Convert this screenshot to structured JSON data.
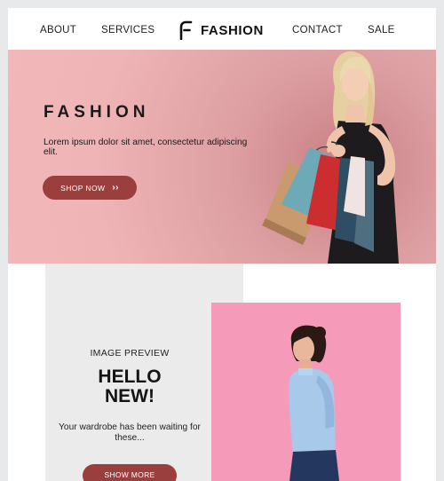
{
  "nav": {
    "links": [
      "ABOUT",
      "SERVICES",
      "CONTACT",
      "SALE"
    ],
    "logo_text": "FASHION",
    "logo_icon": "f-monogram-icon"
  },
  "hero": {
    "title": "FASHION",
    "body": "Lorem ipsum dolor sit amet, consectetur adipiscing elit.",
    "button_label": "SHOP NOW",
    "button_icon": "double-chevron-right-icon",
    "background_color": "#f1b7b9",
    "button_color": "#9b3e3e"
  },
  "feature": {
    "eyebrow": "IMAGE PREVIEW",
    "headline_line1": "HELLO",
    "headline_line2": "NEW!",
    "body": "Your wardrobe has been waiting for these...",
    "button_label": "SHOW MORE",
    "panel_color": "#ebebec",
    "photo_background": "#f59bb9"
  }
}
